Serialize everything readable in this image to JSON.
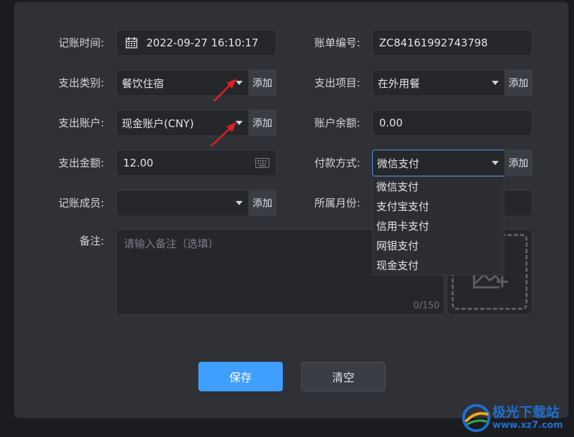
{
  "form": {
    "record_time_label": "记账时间:",
    "record_time_value": "2022-09-27 16:10:17",
    "bill_no_label": "账单编号:",
    "bill_no_value": "ZC84161992743798",
    "expense_category_label": "支出类别:",
    "expense_category_value": "餐饮住宿",
    "expense_item_label": "支出项目:",
    "expense_item_value": "在外用餐",
    "expense_account_label": "支出账户:",
    "expense_account_value": "现金账户(CNY)",
    "account_balance_label": "账户余额:",
    "account_balance_value": "0.00",
    "expense_amount_label": "支出金额:",
    "expense_amount_value": "12.00",
    "payment_method_label": "付款方式:",
    "payment_method_value": "微信支付",
    "member_label": "记账成员:",
    "member_value": "",
    "month_label": "所属月份:",
    "note_label": "备注:",
    "note_placeholder": "请输入备注（选填）",
    "note_counter": "0/150",
    "add_label": "添加"
  },
  "payment_options": [
    "微信支付",
    "支付宝支付",
    "信用卡支付",
    "网银支付",
    "现金支付"
  ],
  "buttons": {
    "save": "保存",
    "clear": "清空"
  },
  "watermark": {
    "line1": "极光下载站",
    "line2": "www.xz7.com"
  },
  "colors": {
    "accent": "#409eff",
    "annotation_arrow": "#e02020"
  }
}
